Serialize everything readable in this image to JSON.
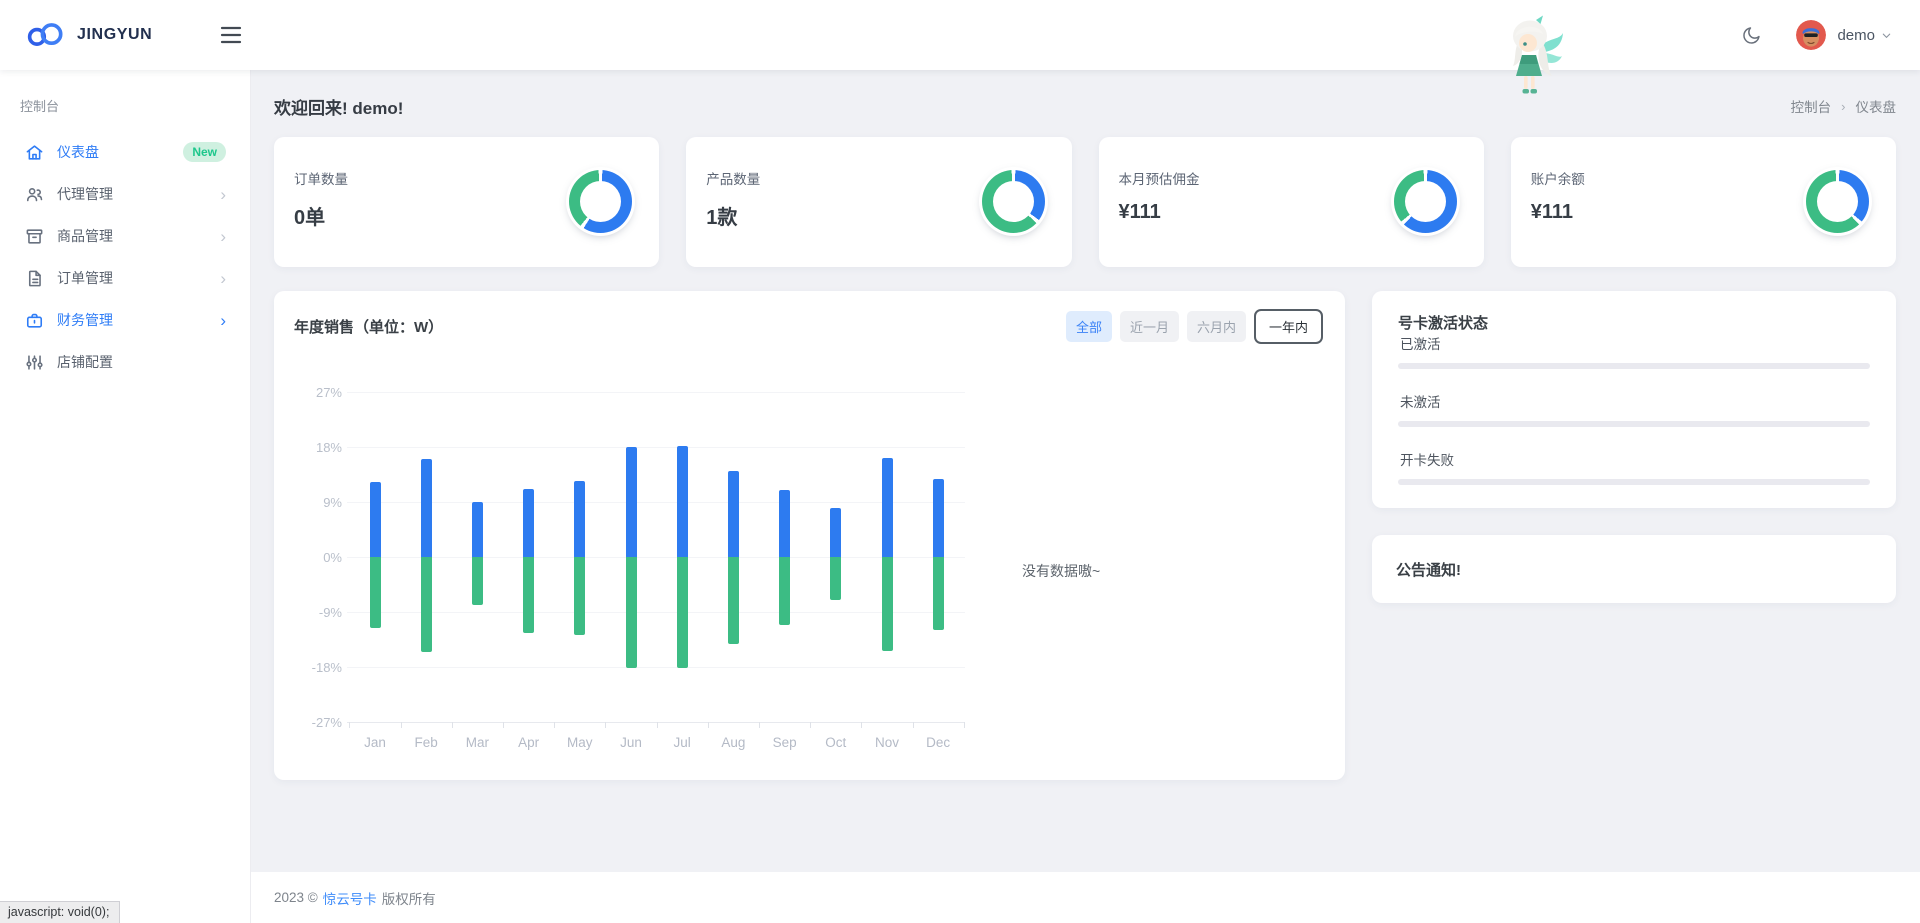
{
  "colors": {
    "primary": "#2d7bf0",
    "green": "#3cbc84",
    "badge_bg": "#cff0e0",
    "badge_text": "#1ec78c"
  },
  "header": {
    "brand": "JINGYUN",
    "user": "demo"
  },
  "sidebar": {
    "section": "控制台",
    "items": [
      {
        "label": "仪表盘",
        "badge": "New",
        "active": true
      },
      {
        "label": "代理管理",
        "expandable": true
      },
      {
        "label": "商品管理",
        "expandable": true
      },
      {
        "label": "订单管理",
        "expandable": true
      },
      {
        "label": "财务管理",
        "expandable": true,
        "active": true
      },
      {
        "label": "店铺配置"
      }
    ]
  },
  "page": {
    "welcome": "欢迎回来! demo!",
    "breadcrumb_root": "控制台",
    "breadcrumb_sep": "›",
    "breadcrumb_current": "仪表盘"
  },
  "stats": [
    {
      "label": "订单数量",
      "value": "0单",
      "donut_blue_pct": 60
    },
    {
      "label": "产品数量",
      "value": "1款",
      "donut_blue_pct": 36
    },
    {
      "label": "本月预估佣金",
      "value": "¥111",
      "donut_blue_pct": 63
    },
    {
      "label": "账户余额",
      "value": "¥111",
      "donut_blue_pct": 37
    }
  ],
  "chart_card": {
    "title": "年度销售（单位：W）",
    "filters": [
      "全部",
      "近一月",
      "六月内",
      "一年内"
    ],
    "active_filter": "全部",
    "selected_filter": "一年内",
    "empty_text": "没有数据嗷~"
  },
  "chart_data": {
    "type": "bar",
    "title": "年度销售（单位：W）",
    "categories": [
      "Jan",
      "Feb",
      "Mar",
      "Apr",
      "May",
      "Jun",
      "Jul",
      "Aug",
      "Sep",
      "Oct",
      "Nov",
      "Dec"
    ],
    "series": [
      {
        "color": "#2d7bf0",
        "values": [
          12.3,
          16.1,
          9.0,
          11.2,
          12.5,
          18.0,
          18.1,
          14.0,
          11.0,
          8.0,
          16.2,
          12.8
        ]
      },
      {
        "color": "#3cbc84",
        "values": [
          -11.6,
          -15.6,
          -7.9,
          -12.5,
          -12.7,
          -18.1,
          -18.2,
          -14.2,
          -11.2,
          -7.0,
          -15.3,
          -11.9
        ]
      }
    ],
    "ylim": [
      -27,
      27
    ],
    "ytick_labels": [
      "27%",
      "18%",
      "9%",
      "0%",
      "-9%",
      "-18%",
      "-27%"
    ],
    "grid": true,
    "legend_position": "none"
  },
  "activation_panel": {
    "title": "号卡激活状态",
    "items": [
      {
        "label": "已激活",
        "progress": 0
      },
      {
        "label": "未激活",
        "progress": 0
      },
      {
        "label": "开卡失败",
        "progress": 0
      }
    ]
  },
  "notice_card": {
    "title": "公告通知!"
  },
  "footer": {
    "prefix": "2023 ©",
    "brand": "惊云号卡",
    "suffix": "版权所有"
  },
  "status_bar": "javascript: void(0);"
}
